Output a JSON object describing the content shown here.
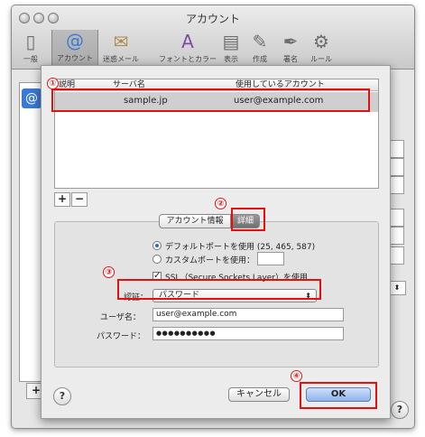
{
  "window": {
    "title": "アカウント"
  },
  "toolbar": [
    {
      "label": "一般",
      "icon": "general-icon"
    },
    {
      "label": "アカウント",
      "icon": "at-icon"
    },
    {
      "label": "迷惑メール",
      "icon": "junk-mail-icon"
    },
    {
      "label": "フォントとカラー",
      "icon": "fonts-colors-icon"
    },
    {
      "label": "表示",
      "icon": "view-icon"
    },
    {
      "label": "作成",
      "icon": "compose-icon"
    },
    {
      "label": "署名",
      "icon": "signature-icon"
    },
    {
      "label": "ルール",
      "icon": "rules-icon"
    }
  ],
  "sheet": {
    "columns": [
      "説明",
      "サーバ名",
      "使用しているアカウント"
    ],
    "rows": [
      {
        "description": "",
        "server": "sample.jp",
        "account": "user@example.com"
      }
    ],
    "add_label": "+",
    "remove_label": "−",
    "tabs": [
      "アカウント情報",
      "詳細"
    ],
    "default_port_label": "デフォルトポートを使用 (25, 465, 587)",
    "custom_port_label": "カスタムポートを使用：",
    "custom_port_value": "",
    "ssl_label": "SSL（Secure Sockets Layer）を使用",
    "auth_label": "認証：",
    "auth_value": "パスワード",
    "username_label": "ユーザ名：",
    "username_value": "user@example.com",
    "password_label": "パスワード：",
    "password_value": "●●●●●●●●●●",
    "cancel_label": "キャンセル",
    "ok_label": "OK",
    "help_label": "?"
  },
  "annotations": [
    "①",
    "②",
    "③",
    "④"
  ],
  "colors": {
    "highlight": "#e41010",
    "selection": "#cfcfcf",
    "ok_button": "#8fb3ec"
  }
}
